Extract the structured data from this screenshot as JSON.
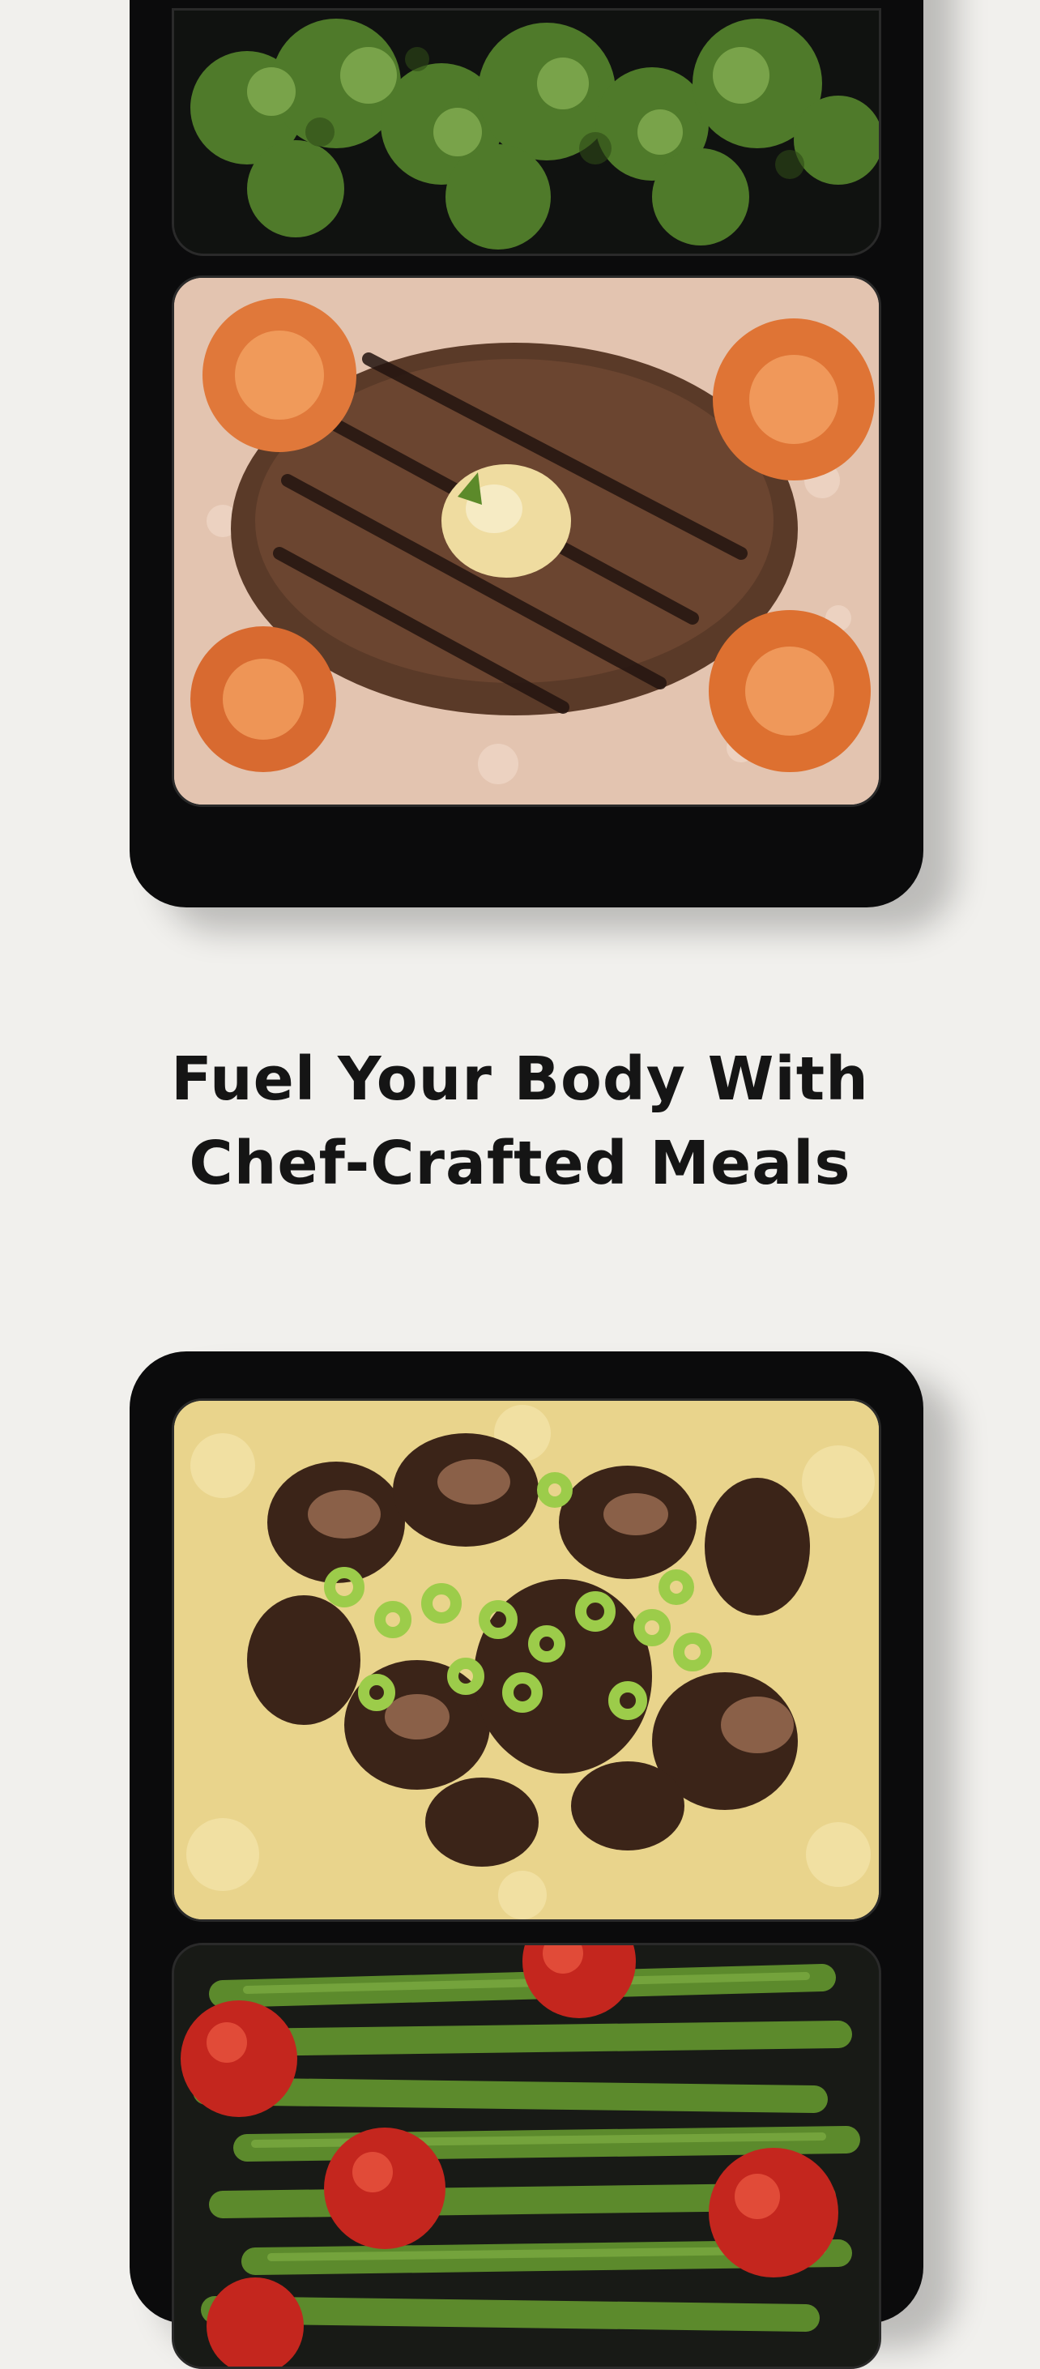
{
  "headline": {
    "line1": "Fuel Your Body With",
    "line2": "Chef-Crafted Meals"
  },
  "images": {
    "top_meal": "steak-shrimp-risotto-broccoli-meal-tray",
    "bottom_meal": "mushroom-mashed-potatoes-green-beans-meal-tray"
  }
}
